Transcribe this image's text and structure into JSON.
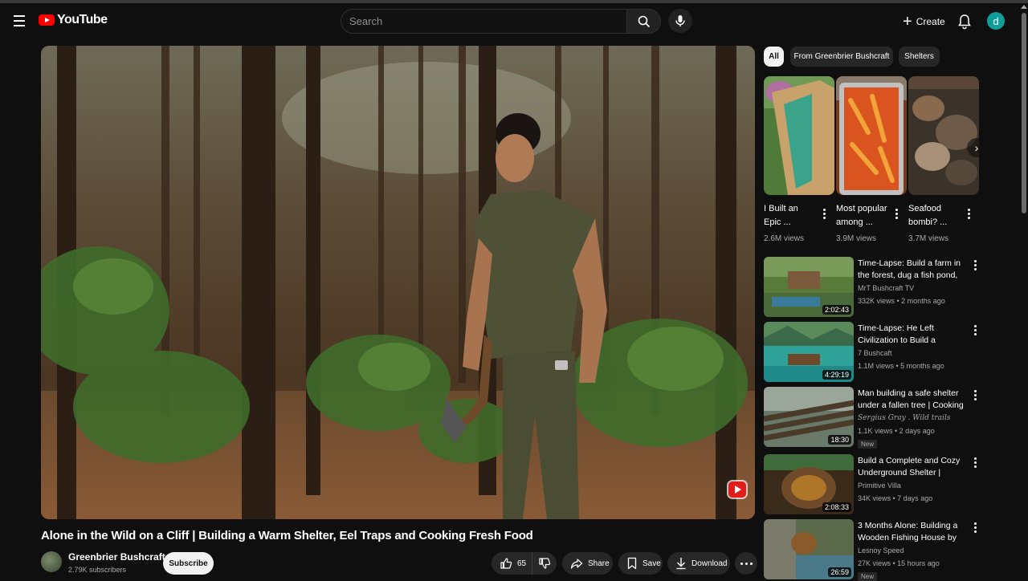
{
  "header": {
    "logo_text": "YouTube",
    "search_placeholder": "Search",
    "create_label": "Create",
    "avatar_letter": "d"
  },
  "video": {
    "title": "Alone in the Wild on a Cliff | Building a Warm Shelter, Eel Traps and Cooking Fresh Food",
    "channel": "Greenbrier Bushcraft",
    "subscribers": "2.79K subscribers",
    "subscribe_label": "Subscribe",
    "like_count": "65",
    "share_label": "Share",
    "save_label": "Save",
    "download_label": "Download"
  },
  "chips": [
    "All",
    "From Greenbrier Bushcraft",
    "Shelters"
  ],
  "shorts": [
    {
      "title": "I Built an Epic ...",
      "views": "2.6M views"
    },
    {
      "title": "Most popular among ...",
      "views": "3.9M views"
    },
    {
      "title": "Seafood bombi? ...",
      "views": "3.7M views"
    }
  ],
  "recommendations": [
    {
      "title": "Time-Lapse: Build a farm in the forest, dug a fish pond, grew ...",
      "channel": "MrT Bushcraft TV",
      "meta": "332K views • 2 months ago",
      "duration": "2:02:43",
      "badge": ""
    },
    {
      "title": "Time-Lapse: He Left Civilization to Build a Floating...",
      "channel": "7 Bushcaft",
      "meta": "1.1M views • 5 months ago",
      "duration": "4:29:19",
      "badge": ""
    },
    {
      "title": "Man building a safe shelter under a fallen tree | Cooking ...",
      "channel": "Sergius Gray . Wild trails",
      "meta": "1.1K views • 2 days ago",
      "duration": "18:30",
      "badge": "New"
    },
    {
      "title": "Build a Complete and Cozy Underground Shelter | Primitiv...",
      "channel": "Primitive Villa",
      "meta": "34K views • 7 days ago",
      "duration": "2:08:33",
      "badge": ""
    },
    {
      "title": "3 Months Alone: Building a Wooden Fishing House by the ...",
      "channel": "Lesnoy Speed",
      "meta": "27K views • 15 hours ago",
      "duration": "26:59",
      "badge": "New"
    }
  ],
  "colors": {
    "accent": "#ff0000",
    "background": "#0f0f0f",
    "avatar": "#0f9d9a"
  }
}
